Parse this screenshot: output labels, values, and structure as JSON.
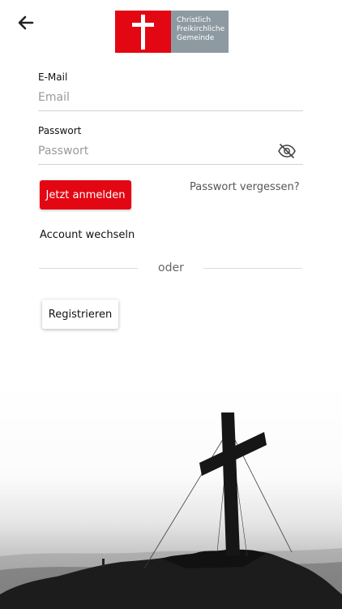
{
  "header": {
    "back_icon": "arrow-left-icon",
    "logo": {
      "line1": "Christlich",
      "line2": "Freikirchliche",
      "line3": "Gemeinde",
      "red": "#e30613",
      "grey": "#8e9aa2"
    }
  },
  "form": {
    "email_label": "E-Mail",
    "email_placeholder": "Email",
    "password_label": "Passwort",
    "password_placeholder": "Passwort",
    "password_toggle_icon": "eye-off-icon"
  },
  "actions": {
    "login_label": "Jetzt anmelden",
    "forgot_label": "Passwort vergessen?",
    "switch_account_label": "Account wechseln",
    "divider_label": "oder",
    "register_label": "Registrieren"
  },
  "colors": {
    "accent": "#e30613",
    "text": "#111111",
    "muted": "#9a9a9a"
  }
}
